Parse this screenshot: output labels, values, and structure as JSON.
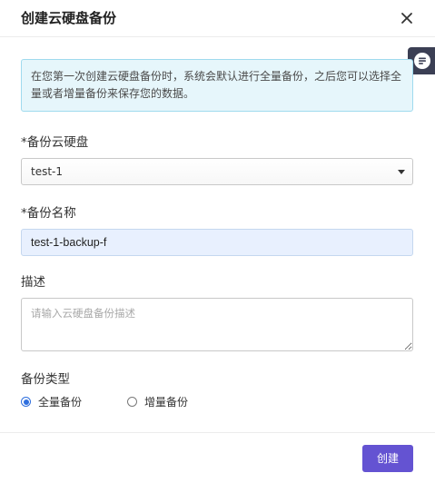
{
  "dialog": {
    "title": "创建云硬盘备份",
    "close_icon": "close-icon",
    "side_tab_icon": "chat-bubble-icon"
  },
  "info": {
    "text": "在您第一次创建云硬盘备份时，系统会默认进行全量备份，之后您可以选择全量或者增量备份来保存您的数据。"
  },
  "form": {
    "volume": {
      "label": "*备份云硬盘",
      "selected": "test-1"
    },
    "name": {
      "label": "*备份名称",
      "value": "test-1-backup-f"
    },
    "description": {
      "label": "描述",
      "placeholder": "请输入云硬盘备份描述",
      "value": ""
    },
    "backup_type": {
      "label": "备份类型",
      "options": [
        {
          "label": "全量备份",
          "checked": true
        },
        {
          "label": "增量备份",
          "checked": false
        }
      ]
    }
  },
  "footer": {
    "create_label": "创建"
  },
  "colors": {
    "primary": "#6453d2",
    "radio_accent": "#2f6fde",
    "info_bg": "#e6f6fb",
    "info_border": "#9fdaee",
    "side_tab_bg": "#3b3f54"
  }
}
